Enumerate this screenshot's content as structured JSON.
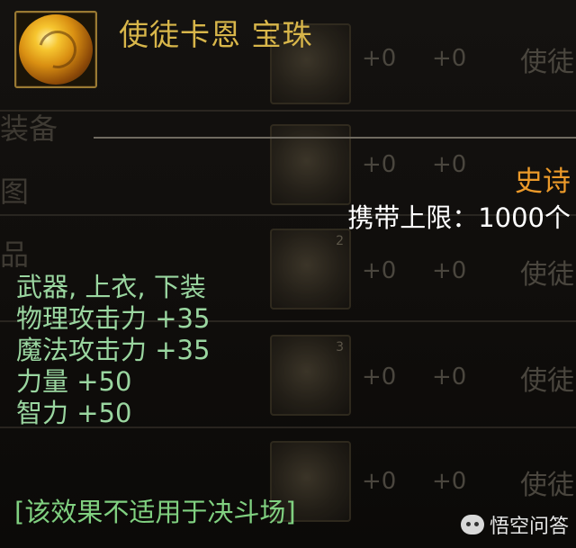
{
  "item": {
    "name": "使徒卡恩 宝珠",
    "icon": "golden-orb-icon",
    "rarity": "史诗",
    "carry_limit": "携带上限：1000个"
  },
  "stats": [
    "武器, 上衣, 下装",
    "物理攻击力 +35",
    "魔法攻击力 +35",
    "力量 +50",
    "智力 +50"
  ],
  "notice": "[该效果不适用于决斗场]",
  "background": {
    "plus_label": "+0",
    "row_name": "使徒",
    "slot_numbers": [
      "2",
      "3"
    ],
    "sidebar_glyphs": [
      "装备",
      "图",
      "品"
    ]
  },
  "watermark": {
    "text": "悟空问答",
    "icon": "wukong-logo-icon"
  },
  "colors": {
    "item_name": "#d8b64a",
    "rarity_epic": "#ec9a2a",
    "stat_text": "#9ad6a0",
    "notice_text": "#80d080",
    "carry_text": "#ffffff"
  }
}
